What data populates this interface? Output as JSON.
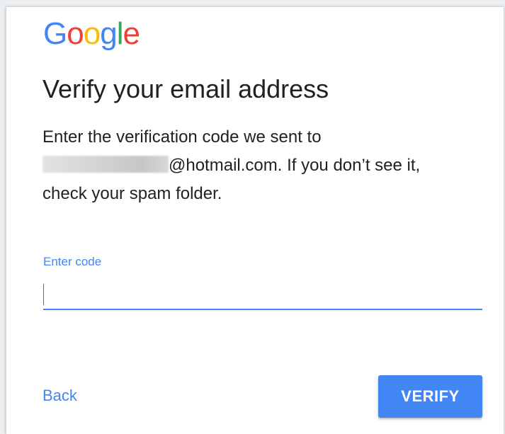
{
  "logo": {
    "letters": [
      {
        "char": "G",
        "color": "#4285F4"
      },
      {
        "char": "o",
        "color": "#EA4335"
      },
      {
        "char": "o",
        "color": "#FBBC05"
      },
      {
        "char": "g",
        "color": "#4285F4"
      },
      {
        "char": "l",
        "color": "#34A853"
      },
      {
        "char": "e",
        "color": "#EA4335"
      }
    ]
  },
  "heading": "Verify your email address",
  "description": {
    "line1": "Enter the verification code we sent to",
    "email_suffix": "@hotmail.com. If you don’t see it,",
    "line3": "check your spam folder."
  },
  "code_field": {
    "label": "Enter code",
    "value": ""
  },
  "actions": {
    "back_label": "Back",
    "verify_label": "VERIFY"
  },
  "colors": {
    "accent": "#4285f4",
    "text": "#202124"
  }
}
